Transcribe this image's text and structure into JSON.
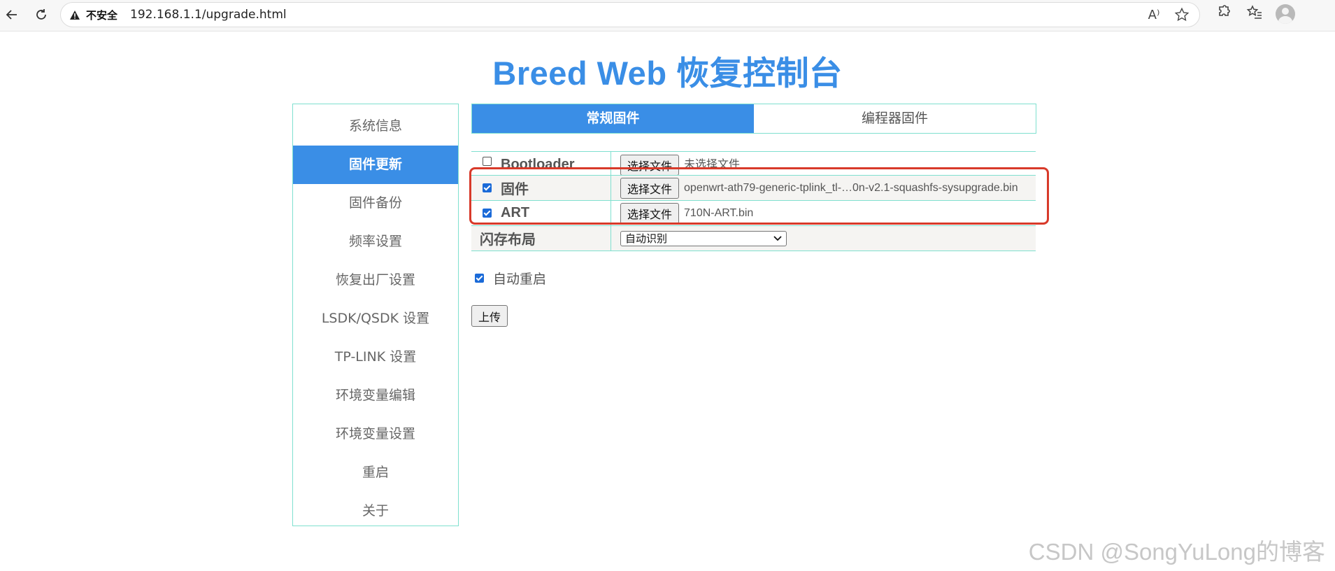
{
  "browser": {
    "security_label": "不安全",
    "url": "192.168.1.1/upgrade.html",
    "read_aloud_glyph": "A⁾"
  },
  "page": {
    "title": "Breed Web 恢复控制台"
  },
  "sidebar": {
    "items": [
      {
        "label": "系统信息"
      },
      {
        "label": "固件更新"
      },
      {
        "label": "固件备份"
      },
      {
        "label": "频率设置"
      },
      {
        "label": "恢复出厂设置"
      },
      {
        "label": "LSDK/QSDK 设置"
      },
      {
        "label": "TP-LINK 设置"
      },
      {
        "label": "环境变量编辑"
      },
      {
        "label": "环境变量设置"
      },
      {
        "label": "重启"
      },
      {
        "label": "关于"
      }
    ],
    "active_index": 1
  },
  "tabs": [
    {
      "label": "常规固件"
    },
    {
      "label": "编程器固件"
    }
  ],
  "form": {
    "bootloader": {
      "label": "Bootloader",
      "checked": false,
      "button": "选择文件",
      "file": "未选择文件"
    },
    "firmware": {
      "label": "固件",
      "checked": true,
      "button": "选择文件",
      "file": "openwrt-ath79-generic-tplink_tl-…0n-v2.1-squashfs-sysupgrade.bin"
    },
    "art": {
      "label": "ART",
      "checked": true,
      "button": "选择文件",
      "file": "710N-ART.bin"
    },
    "flash_layout": {
      "label": "闪存布局",
      "selected": "自动识别"
    }
  },
  "auto_reboot": {
    "label": "自动重启",
    "checked": true
  },
  "upload_button": "上传",
  "watermark": "CSDN @SongYuLong的博客",
  "colors": {
    "accent": "#3a8ee6",
    "border": "#7fe0cf",
    "highlight": "#d83a2a"
  }
}
